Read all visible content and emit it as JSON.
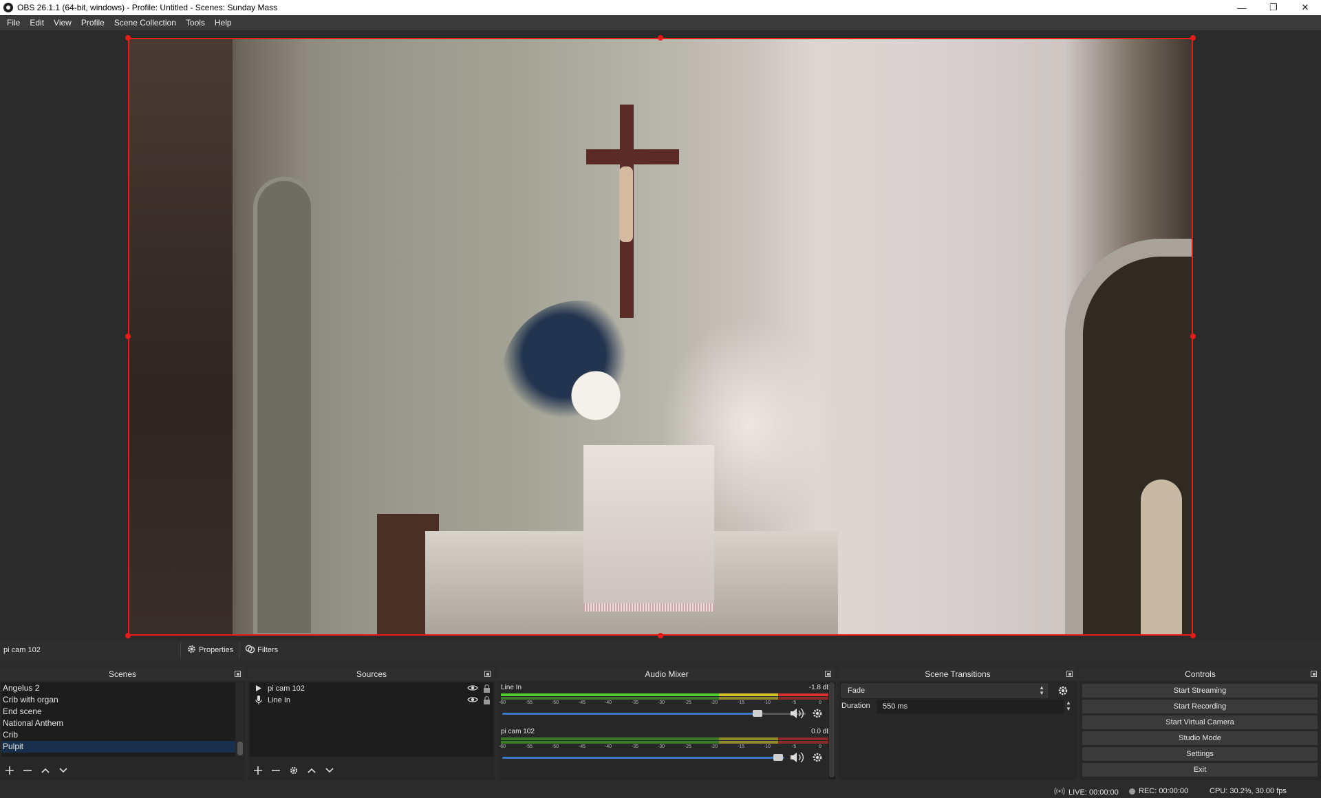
{
  "window": {
    "title": "OBS 26.1.1 (64-bit, windows) - Profile: Untitled - Scenes: Sunday Mass",
    "minimize": "—",
    "restore": "❐",
    "close": "✕"
  },
  "menu": [
    "File",
    "Edit",
    "View",
    "Profile",
    "Scene Collection",
    "Tools",
    "Help"
  ],
  "source_toolbar": {
    "selected_source": "pi cam 102",
    "properties_label": "Properties",
    "filters_label": "Filters"
  },
  "scenes": {
    "title": "Scenes",
    "items": [
      "Angelus 2",
      "Crib with organ",
      "End scene",
      "National Anthem",
      "Crib",
      "Pulpit"
    ],
    "selected": "Pulpit"
  },
  "sources": {
    "title": "Sources",
    "items": [
      {
        "name": "pi cam 102",
        "icon": "play-icon"
      },
      {
        "name": "Line In",
        "icon": "microphone-icon"
      }
    ]
  },
  "audio_mixer": {
    "title": "Audio Mixer",
    "channels": [
      {
        "name": "Line In",
        "db": "-1.8 dB",
        "volume": 0.84
      },
      {
        "name": "pi cam 102",
        "db": "0.0 dB",
        "volume": 1.0
      }
    ],
    "ticks": [
      "-60",
      "-55",
      "-50",
      "-45",
      "-40",
      "-35",
      "-30",
      "-25",
      "-20",
      "-15",
      "-10",
      "-5",
      "0"
    ]
  },
  "scene_transitions": {
    "title": "Scene Transitions",
    "transition": "Fade",
    "duration_label": "Duration",
    "duration_value": "550 ms"
  },
  "controls": {
    "title": "Controls",
    "buttons": [
      "Start Streaming",
      "Start Recording",
      "Start Virtual Camera",
      "Studio Mode",
      "Settings",
      "Exit"
    ]
  },
  "status": {
    "live": "LIVE: 00:00:00",
    "rec": "REC: 00:00:00",
    "cpu": "CPU: 30.2%, 30.00 fps"
  },
  "colors": {
    "selection_red": "#e81b1b",
    "selected_scene": "#19304c",
    "volume_blue": "#3a78c8"
  }
}
